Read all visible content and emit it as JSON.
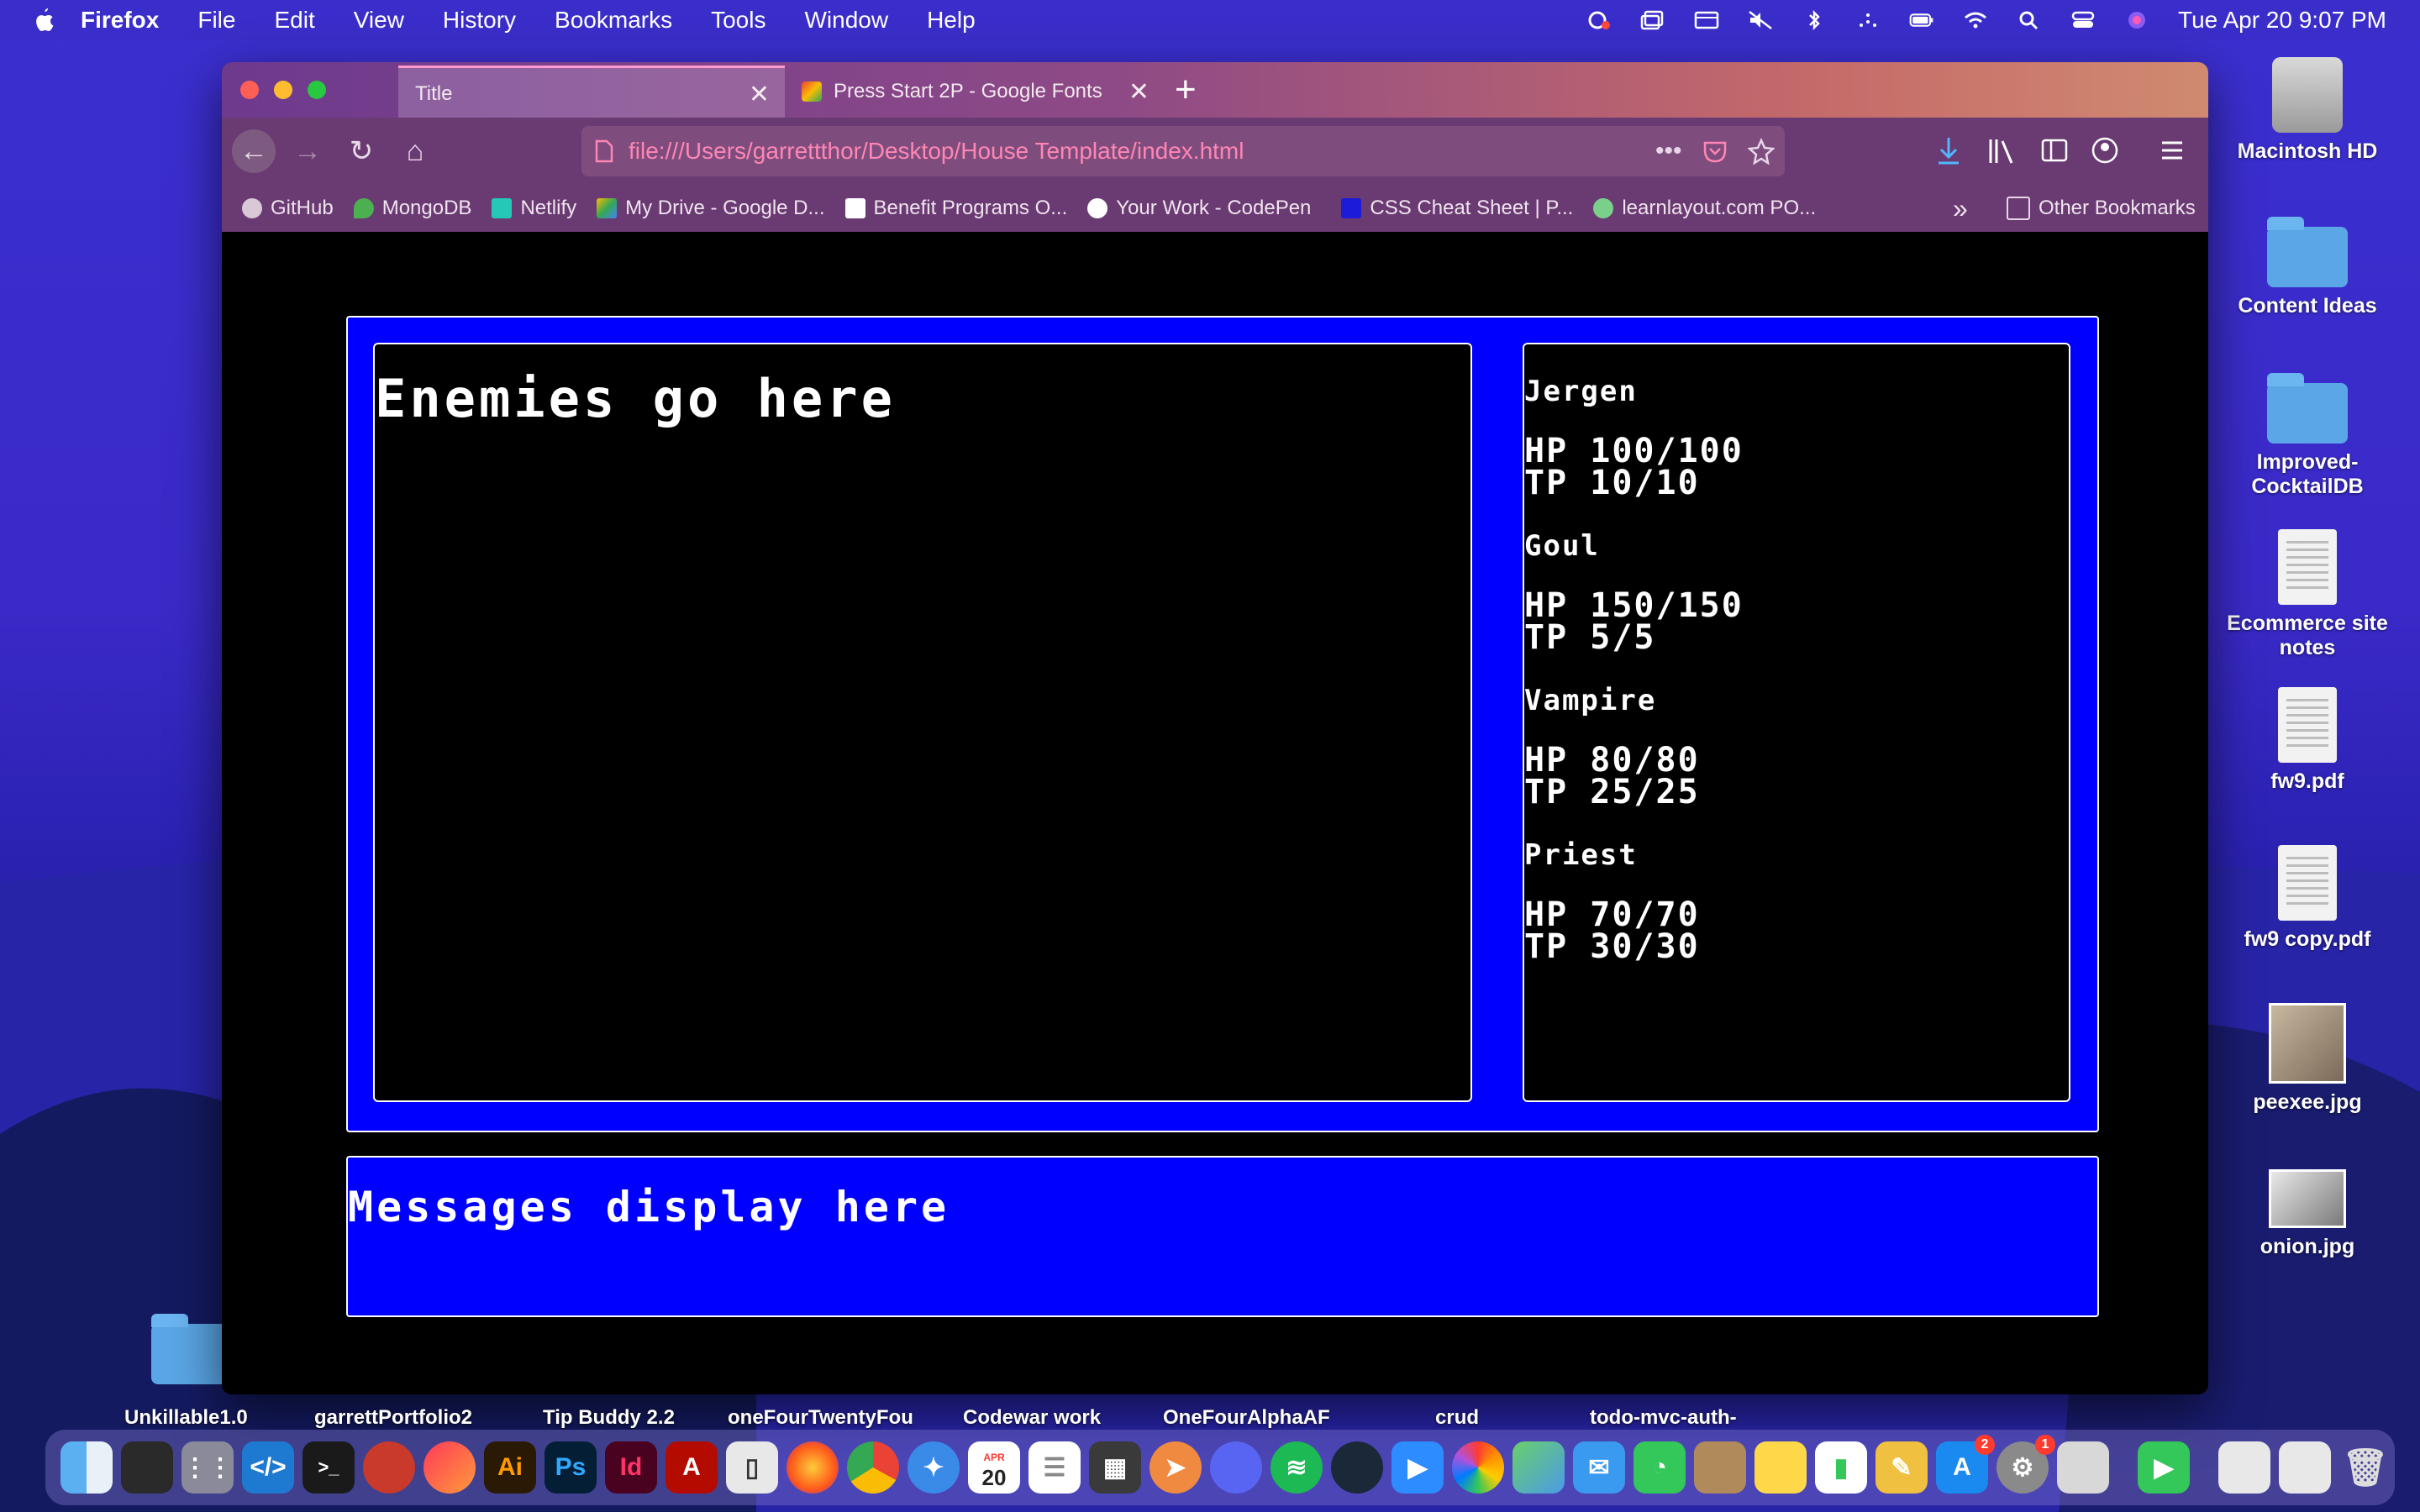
{
  "menubar": {
    "app": "Firefox",
    "items": [
      "File",
      "Edit",
      "View",
      "History",
      "Bookmarks",
      "Tools",
      "Window",
      "Help"
    ],
    "clock": "Tue Apr 20  9:07 PM"
  },
  "desktop": {
    "items": [
      {
        "label": "Macintosh HD",
        "icon": "hard-drive-icon"
      },
      {
        "label": "Content Ideas",
        "icon": "folder-icon"
      },
      {
        "label": "Improved-CocktailDB",
        "icon": "folder-icon"
      },
      {
        "label": "Ecommerce site notes",
        "icon": "document-icon"
      },
      {
        "label": "fw9.pdf",
        "icon": "pdf-icon"
      },
      {
        "label": "fw9 copy.pdf",
        "icon": "pdf-icon"
      },
      {
        "label": "peexee.jpg",
        "icon": "image-icon"
      },
      {
        "label": "onion.jpg",
        "icon": "image-icon"
      }
    ],
    "left_folder": "Unkillable1.0"
  },
  "browser": {
    "tabs": [
      {
        "title": "Title"
      },
      {
        "title": "Press Start 2P - Google Fonts"
      }
    ],
    "url": "file:///Users/garrettthor/Desktop/House Template/index.html",
    "bookmarks": [
      "GitHub",
      "MongoDB",
      "Netlify",
      "My Drive - Google D...",
      "Benefit Programs O...",
      "Your Work - CodePen",
      "CSS Cheat Sheet | P...",
      "learnlayout.com PO..."
    ],
    "other_bookmarks": "Other Bookmarks"
  },
  "game": {
    "enemies_text": "Enemies go here",
    "messages_text": "Messages display here",
    "party": [
      {
        "name": "Jergen",
        "hp": "HP 100/100",
        "tp": "TP 10/10"
      },
      {
        "name": "Goul",
        "hp": "HP 150/150",
        "tp": "TP 5/5"
      },
      {
        "name": "Vampire",
        "hp": "HP 80/80",
        "tp": "TP 25/25"
      },
      {
        "name": "Priest",
        "hp": "HP 70/70",
        "tp": "TP 30/30"
      }
    ]
  },
  "dock": {
    "labels": [
      "Unkillable1.0",
      "garrettPortfolio2",
      "Tip Buddy 2.2",
      "oneFourTwentyFou",
      "Codewar work",
      "OneFourAlphaAF",
      "crud",
      "todo-mvc-auth-"
    ],
    "calendar_month": "APR",
    "calendar_day": "20",
    "appstore_badge": "2",
    "settings_badge": "1"
  }
}
